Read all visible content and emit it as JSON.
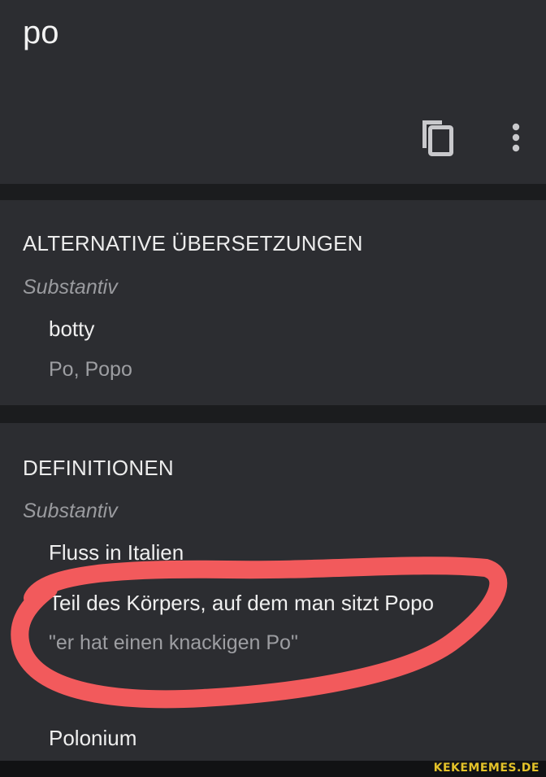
{
  "header": {
    "source_word": "po",
    "copy_icon": "copy-icon",
    "more_icon": "more-vert-icon"
  },
  "alternatives": {
    "title": "ALTERNATIVE ÜBERSETZUNGEN",
    "pos": "Substantiv",
    "word": "botty",
    "back_translations": "Po, Popo"
  },
  "definitions": {
    "title": "DEFINITIONEN",
    "pos": "Substantiv",
    "items": [
      {
        "text": "Fluss in Italien"
      },
      {
        "text": "Teil des Körpers, auf dem man sitzt Popo",
        "example": "\"er hat einen knackigen Po\""
      },
      {
        "text": "Polonium"
      }
    ]
  },
  "annotation": {
    "color": "#f25a5c"
  },
  "watermark": "KEKEMEMES.DE"
}
